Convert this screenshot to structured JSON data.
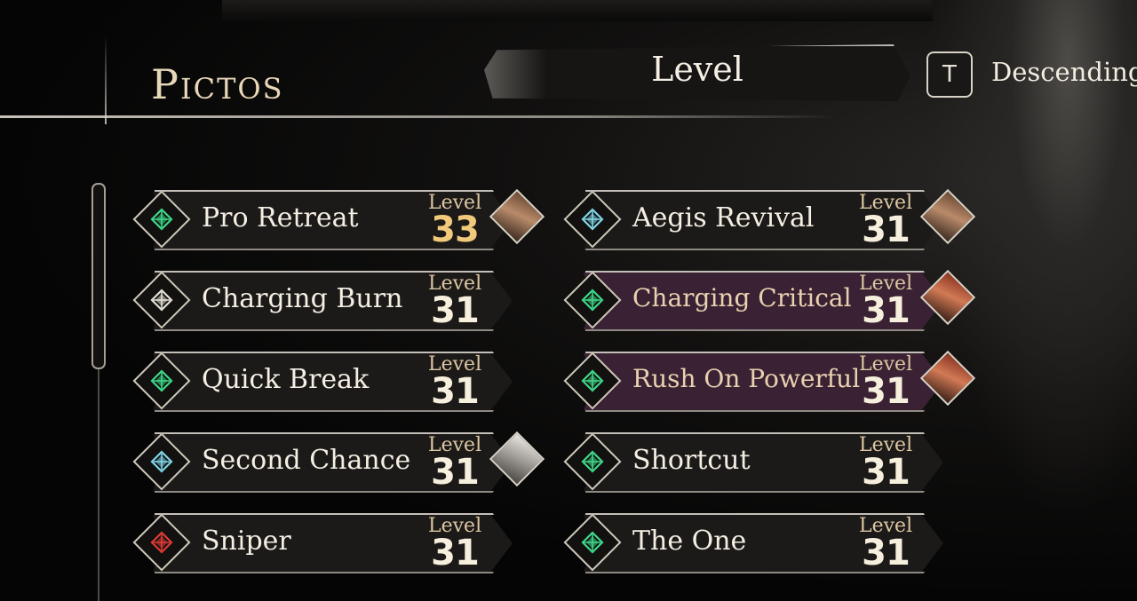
{
  "header": {
    "title": "Pictos",
    "sort_label": "Level",
    "key_hint": "T",
    "sort_order": "Descending"
  },
  "colors": {
    "highlight_row": "#3a2234",
    "gold_level": "#f0c97a"
  },
  "pictos": [
    {
      "name": "Pro Retreat",
      "level_label": "Level",
      "level": "33",
      "icon": "green-rune-icon",
      "portrait": "character-portrait-brunette",
      "gold": true,
      "highlight": false
    },
    {
      "name": "Aegis Revival",
      "level_label": "Level",
      "level": "31",
      "icon": "teal-rune-icon",
      "portrait": "character-portrait-brunette",
      "gold": false,
      "highlight": false
    },
    {
      "name": "Charging Burn",
      "level_label": "Level",
      "level": "31",
      "icon": "white-rune-icon",
      "portrait": null,
      "gold": false,
      "highlight": false
    },
    {
      "name": "Charging Critical",
      "level_label": "Level",
      "level": "31",
      "icon": "green-rune-icon",
      "portrait": "character-portrait-redhead",
      "gold": false,
      "highlight": true
    },
    {
      "name": "Quick Break",
      "level_label": "Level",
      "level": "31",
      "icon": "green-rune-icon",
      "portrait": null,
      "gold": false,
      "highlight": false
    },
    {
      "name": "Rush On Powerful",
      "level_label": "Level",
      "level": "31",
      "icon": "green-rune-icon",
      "portrait": "character-portrait-redhead",
      "gold": false,
      "highlight": true
    },
    {
      "name": "Second Chance",
      "level_label": "Level",
      "level": "31",
      "icon": "teal-rune-icon",
      "portrait": "character-portrait-grey",
      "gold": false,
      "highlight": false
    },
    {
      "name": "Shortcut",
      "level_label": "Level",
      "level": "31",
      "icon": "green-rune-icon",
      "portrait": null,
      "gold": false,
      "highlight": false
    },
    {
      "name": "Sniper",
      "level_label": "Level",
      "level": "31",
      "icon": "red-rune-icon",
      "portrait": null,
      "gold": false,
      "highlight": false
    },
    {
      "name": "The One",
      "level_label": "Level",
      "level": "31",
      "icon": "green-rune-icon",
      "portrait": null,
      "gold": false,
      "highlight": false
    }
  ]
}
